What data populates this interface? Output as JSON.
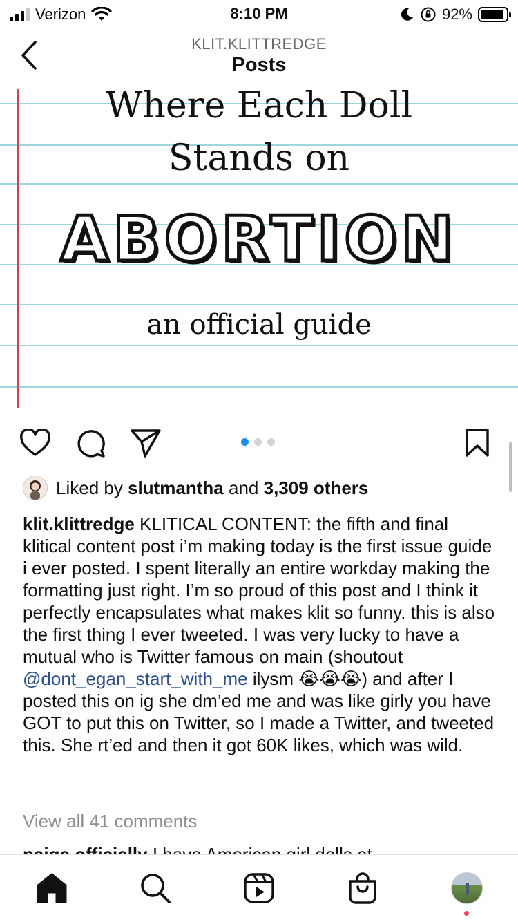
{
  "status_bar": {
    "carrier": "Verizon",
    "time": "8:10 PM",
    "battery_percent": "92%",
    "battery_level": 0.92
  },
  "header": {
    "username": "KLIT.KLITTREDGE",
    "title": "Posts"
  },
  "post_image": {
    "line1": "Where Each Doll",
    "line2": "Stands on",
    "headline": "ABORTION",
    "subtitle": "an official guide"
  },
  "carousel": {
    "count": 3,
    "active_index": 0
  },
  "likes": {
    "prefix": "Liked by",
    "liker": "slutmantha",
    "joiner": "and",
    "others": "3,309 others"
  },
  "caption": {
    "username": "klit.klittredge",
    "text_before_mention": " KLITICAL CONTENT: the fifth and final klitical content post i’m making today is the first issue guide i ever posted. I spent literally an entire workday making the formatting just right. I’m so proud of this post and I think it perfectly encapsulates what makes klit so funny. this is also the first thing I ever tweeted. I was very lucky to have a mutual who is Twitter famous on main (shoutout ",
    "mention": "@dont_egan_start_with_me",
    "text_after_mention": " ilysm 😭😭😭) and after I posted this on ig she dm’ed me and was like girly you have GOT to put this on Twitter, so I made a Twitter, and tweeted this. She rt’ed and then it got 60K likes, which was wild."
  },
  "comments": {
    "view_all": "View all 41 comments",
    "preview_user": "paige.officially",
    "preview_text": " I have American girl dolls at"
  },
  "icons": {
    "back": "chevron-left-icon",
    "like": "heart-icon",
    "comment": "comment-bubble-icon",
    "share": "paper-plane-icon",
    "save": "bookmark-icon",
    "home": "home-icon",
    "search": "search-icon",
    "reels": "reels-icon",
    "shop": "shopping-bag-icon"
  },
  "colors": {
    "accent": "#1f8cf0",
    "mention": "#2a4f8a",
    "notification": "#ed4956",
    "ruled_line": "#9ad7dc",
    "margin_line": "#c84a4a"
  }
}
